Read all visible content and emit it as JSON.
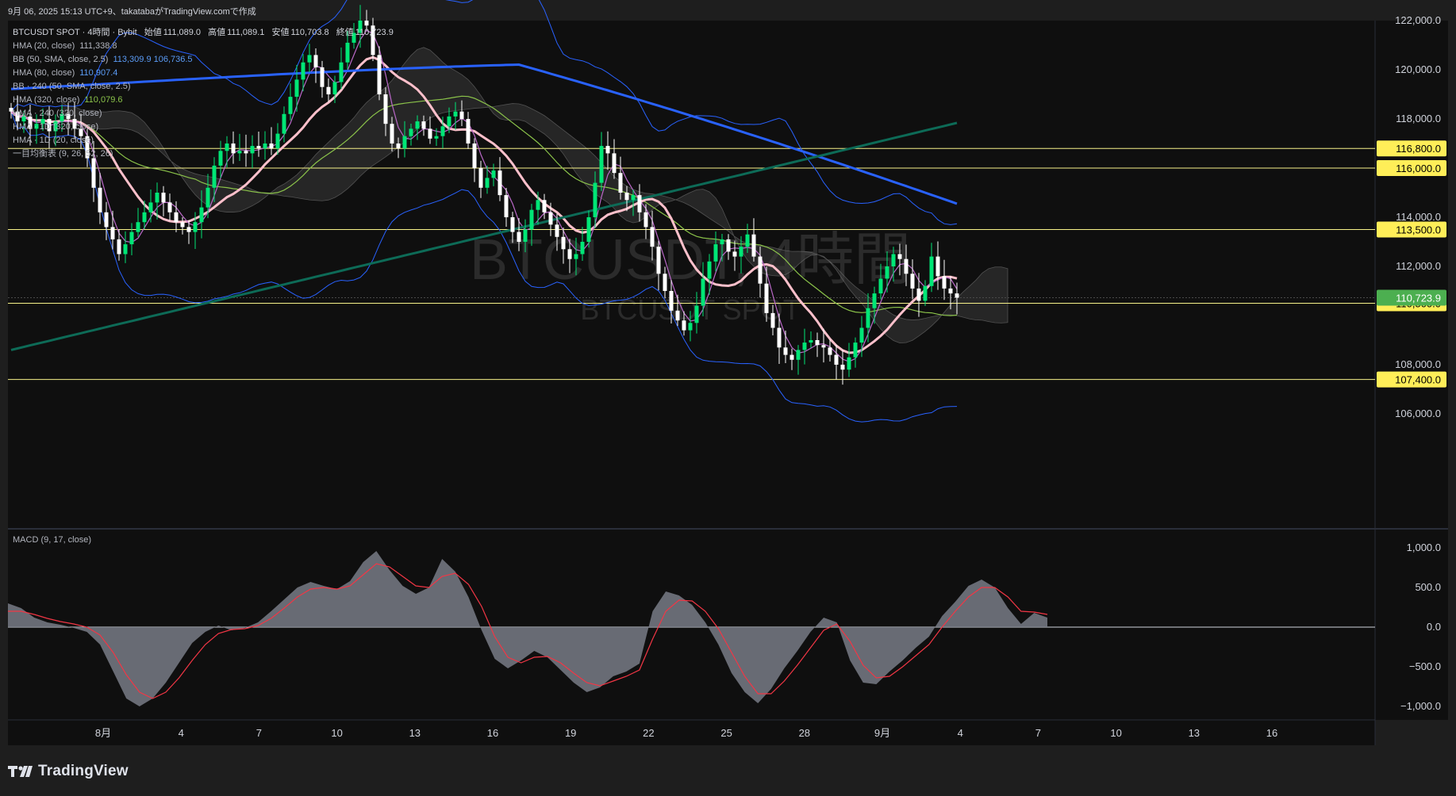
{
  "header": {
    "caption": "9月 06, 2025 15:13 UTC+9、takatabaがTradingView.comで作成"
  },
  "legend": {
    "symbol_line": "BTCUSDT SPOT · 4時間 · Bybit",
    "ohlc": {
      "open_label": "始値",
      "open": "111,089.0",
      "high_label": "高値",
      "high": "111,089.1",
      "low_label": "安値",
      "low": "110,703.8",
      "close_label": "終値",
      "close": "110,723.9"
    },
    "indicators": [
      {
        "label": "HMA (20, close)",
        "value": "111,338.8",
        "color": "#b2b5be"
      },
      {
        "label": "BB (50, SMA, close, 2.5)",
        "value": "113,309.9  106,736.5",
        "color": "#5b9cf6"
      },
      {
        "label": "HMA (80, close)",
        "value": "110,907.4",
        "color": "#5b9cf6"
      },
      {
        "label": "BB · 240 (50, SMA, close, 2.5)",
        "value": "",
        "color": "#b2b5be"
      },
      {
        "label": "HMA (320, close)",
        "value": "110,079.6",
        "color": "#8bc34a"
      },
      {
        "label": "HMA · 240 (320, close)",
        "value": "",
        "color": "#b2b5be"
      },
      {
        "label": "HMA · 1D (320, close)",
        "value": "",
        "color": "#b2b5be"
      },
      {
        "label": "HMA · 1D (20, close)",
        "value": "",
        "color": "#b2b5be"
      },
      {
        "label": "一目均衡表 (9, 26, 52, 26)",
        "value": "",
        "color": "#b2b5be"
      }
    ]
  },
  "watermark": {
    "title": "BTCUSDT, 4時間",
    "subtitle": "BTCUSDT SPOT"
  },
  "colors": {
    "background": "#0f0f0f",
    "page": "#1e1e1e",
    "up_candle": "#00e676",
    "down_candle": "#ffffff",
    "hline": "#f7f28a",
    "label_bg": "#ffee58",
    "last_price": "#4caf50",
    "macd_hist": "#787b86",
    "macd_signal": "#f23645",
    "hma_blue": "#2962ff",
    "hma_pink": "#ffc0cb",
    "hma_green": "#8bc34a",
    "hma_teal": "#0d6b57",
    "bb": "#2962ff",
    "hma_purple": "#ba68c8"
  },
  "chart_data": [
    {
      "type": "candlestick",
      "title": "BTCUSDT SPOT · 4時間 · Bybit",
      "y_axis_ticks": [
        "122,000.0",
        "120,000.0",
        "118,000.0",
        "114,000.0",
        "112,000.0",
        "108,000.0",
        "106,000.0"
      ],
      "ylim": [
        105000,
        122000
      ],
      "x_axis_ticks": [
        "8月",
        "4",
        "7",
        "10",
        "13",
        "16",
        "19",
        "22",
        "25",
        "28",
        "9月",
        "4",
        "7",
        "10",
        "13",
        "16"
      ],
      "horizontal_lines": [
        {
          "value": 116800,
          "label": "116,800.0"
        },
        {
          "value": 116000,
          "label": "116,000.0"
        },
        {
          "value": 113500,
          "label": "113,500.0"
        },
        {
          "value": 110500,
          "label": "110,500.0"
        },
        {
          "value": 107400,
          "label": "107,400.0"
        }
      ],
      "last_price": {
        "value": 110723.9,
        "label": "110,723.9"
      },
      "close_series": [
        118300,
        117900,
        118100,
        117600,
        117800,
        118000,
        117500,
        117900,
        118200,
        118000,
        117600,
        117300,
        116400,
        115200,
        114200,
        113600,
        113100,
        112500,
        112900,
        113400,
        113800,
        114200,
        114600,
        115000,
        114600,
        114200,
        113800,
        113600,
        113400,
        113800,
        114400,
        115200,
        116100,
        116700,
        117000,
        116600,
        116700,
        116600,
        116900,
        116800,
        117000,
        116800,
        117400,
        118200,
        118900,
        119600,
        120300,
        120600,
        120100,
        119300,
        119000,
        119500,
        120300,
        121100,
        121500,
        122000,
        121800,
        120600,
        119000,
        117800,
        117000,
        116800,
        117300,
        117600,
        117900,
        117600,
        117200,
        117300,
        117700,
        118100,
        118300,
        118000,
        117000,
        116000,
        115200,
        115600,
        115900,
        114900,
        114000,
        113400,
        113000,
        113500,
        114300,
        114700,
        114200,
        113700,
        113200,
        112700,
        112300,
        112500,
        113000,
        114000,
        115400,
        116900,
        116600,
        115800,
        115000,
        114700,
        114900,
        114200,
        113600,
        112800,
        111700,
        111000,
        110200,
        109800,
        109400,
        109700,
        110400,
        111500,
        112200,
        112900,
        113100,
        112600,
        112400,
        112800,
        113300,
        112400,
        111300,
        110100,
        109500,
        108700,
        108400,
        108200,
        108600,
        108900,
        109000,
        108800,
        108700,
        108400,
        108000,
        107800,
        108300,
        108900,
        109500,
        110300,
        110900,
        111500,
        112000,
        112500,
        112300,
        111700,
        111100,
        110600,
        111200,
        112400,
        111600,
        111100,
        110900,
        110723.9
      ],
      "indicator_lines": [
        {
          "name": "HMA (20, close)",
          "value": 111338.8
        },
        {
          "name": "HMA (80, close)",
          "value": 110907.4
        },
        {
          "name": "HMA (320, close)",
          "value": 110079.6
        },
        {
          "name": "BB (50, SMA, close, 2.5) upper",
          "value": 113309.9
        },
        {
          "name": "BB (50, SMA, close, 2.5) lower",
          "value": 106736.5
        }
      ]
    },
    {
      "type": "area",
      "title": "MACD (9, 17, close)",
      "y_axis_ticks": [
        "1,000.0",
        "500.0",
        "0.0",
        "−500.0",
        "−1,000.0"
      ],
      "ylim": [
        -1200,
        1050
      ],
      "series": [
        {
          "name": "MACD",
          "values": [
            300,
            240,
            120,
            60,
            30,
            -10,
            -60,
            -220,
            -560,
            -900,
            -1000,
            -900,
            -700,
            -450,
            -200,
            -60,
            20,
            -40,
            -10,
            60,
            200,
            350,
            500,
            570,
            520,
            480,
            580,
            820,
            960,
            720,
            520,
            420,
            500,
            860,
            700,
            380,
            -40,
            -400,
            -520,
            -420,
            -300,
            -380,
            -540,
            -700,
            -820,
            -760,
            -620,
            -560,
            -460,
            200,
            450,
            400,
            280,
            60,
            -220,
            -580,
            -820,
            -960,
            -780,
            -520,
            -300,
            -60,
            120,
            60,
            -420,
            -700,
            -720,
            -560,
            -420,
            -260,
            -120,
            140,
            320,
            520,
            600,
            500,
            240,
            40,
            180,
            120
          ]
        },
        {
          "name": "Signal",
          "values": [
            200,
            200,
            160,
            110,
            70,
            40,
            0,
            -100,
            -320,
            -600,
            -820,
            -900,
            -820,
            -640,
            -420,
            -220,
            -80,
            -30,
            -20,
            20,
            110,
            240,
            380,
            480,
            500,
            480,
            520,
            660,
            800,
            760,
            640,
            520,
            500,
            640,
            680,
            540,
            260,
            -120,
            -380,
            -450,
            -380,
            -370,
            -450,
            -580,
            -700,
            -740,
            -680,
            -620,
            -540,
            -150,
            200,
            340,
            330,
            200,
            -20,
            -320,
            -620,
            -840,
            -840,
            -680,
            -480,
            -260,
            -40,
            40,
            -180,
            -480,
            -640,
            -620,
            -500,
            -360,
            -220,
            0,
            200,
            380,
            500,
            500,
            380,
            200,
            190,
            160
          ]
        }
      ]
    }
  ],
  "footer": {
    "brand": "TradingView"
  }
}
